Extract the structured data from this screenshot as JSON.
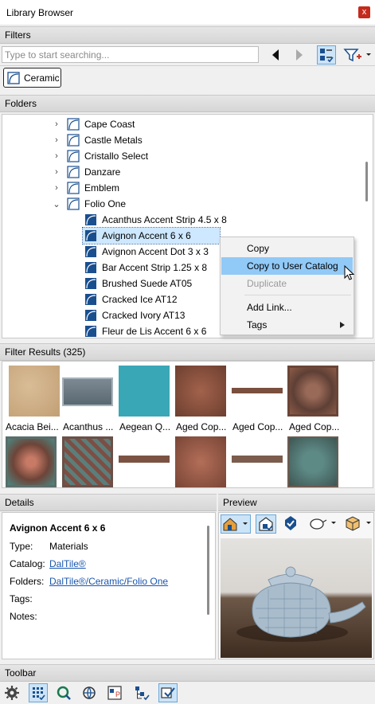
{
  "window": {
    "title": "Library Browser",
    "close_label": "x"
  },
  "filters": {
    "header": "Filters",
    "search_placeholder": "Type to start searching...",
    "chip_label": "Ceramic"
  },
  "folders": {
    "header": "Folders",
    "items": [
      {
        "label": "Cape Coast"
      },
      {
        "label": "Castle Metals"
      },
      {
        "label": "Cristallo Select"
      },
      {
        "label": "Danzare"
      },
      {
        "label": "Emblem"
      },
      {
        "label": "Folio One"
      },
      {
        "label": "Acanthus Accent Strip 4.5 x 8"
      },
      {
        "label": "Avignon Accent 6 x 6"
      },
      {
        "label": "Avignon Accent Dot 3 x 3"
      },
      {
        "label": "Bar Accent Strip 1.25 x 8"
      },
      {
        "label": "Brushed Suede AT05"
      },
      {
        "label": "Cracked Ice AT12"
      },
      {
        "label": "Cracked Ivory AT13"
      },
      {
        "label": "Fleur de Lis Accent 6 x 6"
      }
    ]
  },
  "context_menu": {
    "items": [
      {
        "label": "Copy"
      },
      {
        "label": "Copy to User Catalog"
      },
      {
        "label": "Duplicate"
      },
      {
        "label": "Add Link..."
      },
      {
        "label": "Tags"
      }
    ]
  },
  "results": {
    "header": "Filter Results (325)",
    "items": [
      {
        "label": "Acacia Bei..."
      },
      {
        "label": "Acanthus ..."
      },
      {
        "label": "Aegean Q..."
      },
      {
        "label": "Aged Cop..."
      },
      {
        "label": "Aged Cop..."
      },
      {
        "label": "Aged Cop..."
      }
    ]
  },
  "details": {
    "header": "Details",
    "name": "Avignon Accent 6 x 6",
    "type_key": "Type:",
    "type_val": "Materials",
    "catalog_key": "Catalog:",
    "catalog_val": "DalTile®",
    "folders_key": "Folders:",
    "folders_val": "DalTile®/Ceramic/Folio One",
    "tags_key": "Tags:",
    "notes_key": "Notes:"
  },
  "preview": {
    "header": "Preview"
  },
  "toolbar": {
    "header": "Toolbar"
  },
  "colors": {
    "accent": "#0078d4",
    "menu_highlight": "#91c9f7",
    "selection": "#cde8ff",
    "close": "#c42b1c"
  }
}
